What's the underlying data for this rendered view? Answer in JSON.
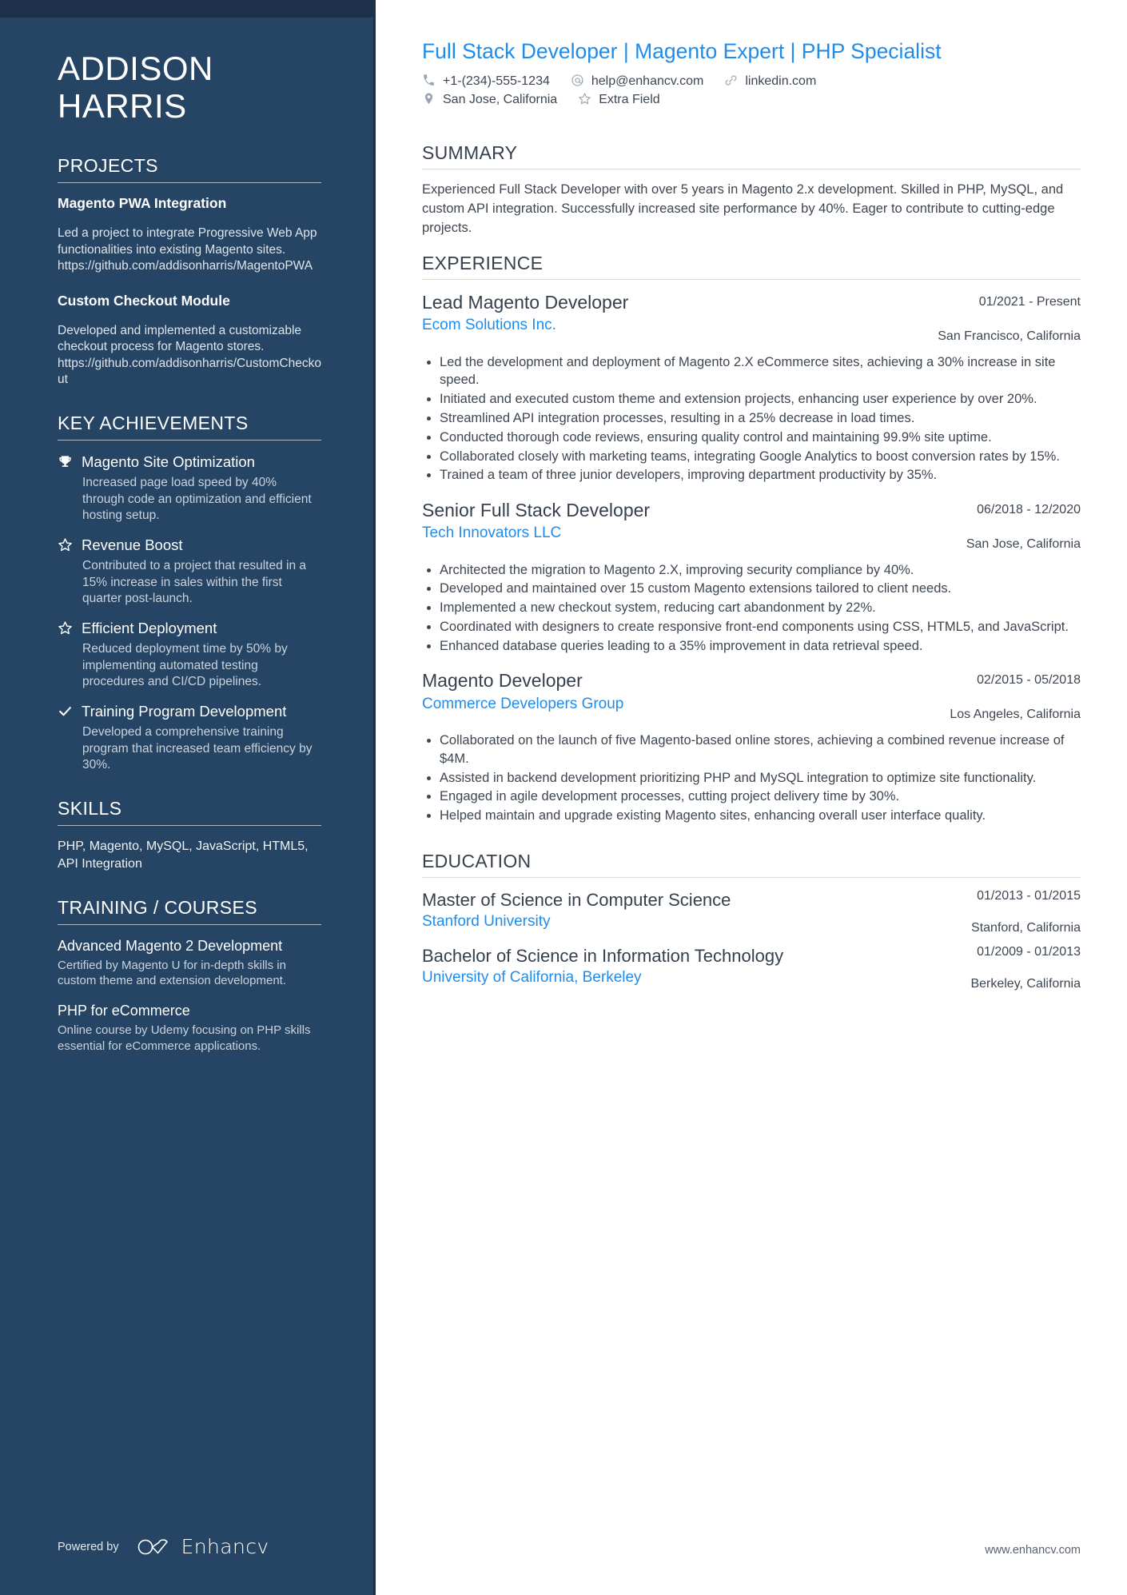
{
  "sidebar": {
    "name_lines": [
      "ADDISON",
      "HARRIS"
    ],
    "projects": {
      "heading": "PROJECTS",
      "items": [
        {
          "title": "Magento PWA Integration",
          "description": "Led a project to integrate Progressive Web App functionalities into existing Magento sites. https://github.com/addisonharris/MagentoPWA"
        },
        {
          "title": "Custom Checkout Module",
          "description": "Developed and implemented a customizable checkout process for Magento stores. https://github.com/addisonharris/CustomCheckout"
        }
      ]
    },
    "key_achievements": {
      "heading": "KEY ACHIEVEMENTS",
      "items": [
        {
          "icon": "trophy-icon",
          "title": "Magento Site Optimization",
          "description": "Increased page load speed by 40% through code an optimization and efficient hosting setup."
        },
        {
          "icon": "star-icon",
          "title": "Revenue Boost",
          "description": "Contributed to a project that resulted in a 15% increase in sales within the first quarter post-launch."
        },
        {
          "icon": "star-icon",
          "title": "Efficient Deployment",
          "description": "Reduced deployment time by 50% by implementing automated testing procedures and CI/CD pipelines."
        },
        {
          "icon": "check-icon",
          "title": "Training Program Development",
          "description": "Developed a comprehensive training program that increased team efficiency by 30%."
        }
      ]
    },
    "skills": {
      "heading": "SKILLS",
      "text": "PHP, Magento, MySQL, JavaScript, HTML5, API Integration"
    },
    "training": {
      "heading": "TRAINING / COURSES",
      "items": [
        {
          "title": "Advanced Magento 2 Development",
          "description": "Certified by Magento U for in-depth skills in custom theme and extension development."
        },
        {
          "title": "PHP for eCommerce",
          "description": "Online course by Udemy focusing on PHP skills essential for eCommerce applications."
        }
      ]
    },
    "footer": {
      "powered_by": "Powered by",
      "brand": "Enhancv"
    }
  },
  "main": {
    "headline": "Full Stack Developer | Magento Expert | PHP Specialist",
    "contact": {
      "row1": [
        {
          "icon": "phone-icon",
          "text": "+1-(234)-555-1234"
        },
        {
          "icon": "email-icon",
          "text": "help@enhancv.com"
        },
        {
          "icon": "link-icon",
          "text": "linkedin.com"
        }
      ],
      "row2": [
        {
          "icon": "location-icon",
          "text": "San Jose, California"
        },
        {
          "icon": "star-outline-icon",
          "text": "Extra Field"
        }
      ]
    },
    "summary": {
      "heading": "SUMMARY",
      "text": "Experienced Full Stack Developer with over 5 years in Magento 2.x development. Skilled in PHP, MySQL, and custom API integration. Successfully increased site performance by 40%. Eager to contribute to cutting-edge projects."
    },
    "experience": {
      "heading": "EXPERIENCE",
      "entries": [
        {
          "title": "Lead Magento Developer",
          "org": "Ecom Solutions Inc.",
          "date": "01/2021 - Present",
          "location": "San Francisco, California",
          "bullets": [
            "Led the development and deployment of Magento 2.X eCommerce sites, achieving a 30% increase in site speed.",
            "Initiated and executed custom theme and extension projects, enhancing user experience by over 20%.",
            "Streamlined API integration processes, resulting in a 25% decrease in load times.",
            "Conducted thorough code reviews, ensuring quality control and maintaining 99.9% site uptime.",
            "Collaborated closely with marketing teams, integrating Google Analytics to boost conversion rates by 15%.",
            "Trained a team of three junior developers, improving department productivity by 35%."
          ]
        },
        {
          "title": "Senior Full Stack Developer",
          "org": "Tech Innovators LLC",
          "date": "06/2018 - 12/2020",
          "location": "San Jose, California",
          "bullets": [
            "Architected the migration to Magento 2.X, improving security compliance by 40%.",
            "Developed and maintained over 15 custom Magento extensions tailored to client needs.",
            "Implemented a new checkout system, reducing cart abandonment by 22%.",
            "Coordinated with designers to create responsive front-end components using CSS, HTML5, and JavaScript.",
            "Enhanced database queries leading to a 35% improvement in data retrieval speed."
          ]
        },
        {
          "title": "Magento Developer",
          "org": "Commerce Developers Group",
          "date": "02/2015 - 05/2018",
          "location": "Los Angeles, California",
          "bullets": [
            "Collaborated on the launch of five Magento-based online stores, achieving a combined revenue increase of $4M.",
            "Assisted in backend development prioritizing PHP and MySQL integration to optimize site functionality.",
            "Engaged in agile development processes, cutting project delivery time by 30%.",
            "Helped maintain and upgrade existing Magento sites, enhancing overall user interface quality."
          ]
        }
      ]
    },
    "education": {
      "heading": "EDUCATION",
      "entries": [
        {
          "title": "Master of Science in Computer Science",
          "org": "Stanford University",
          "date": "01/2013 - 01/2015",
          "location": "Stanford, California"
        },
        {
          "title": "Bachelor of Science in Information Technology",
          "org": "University of California, Berkeley",
          "date": "01/2009 - 01/2013",
          "location": "Berkeley, California"
        }
      ]
    },
    "footer_url": "www.enhancv.com"
  }
}
